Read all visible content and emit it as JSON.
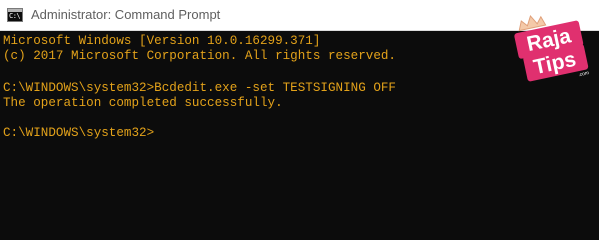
{
  "window": {
    "title": "Administrator: Command Prompt",
    "icon": "cmd-icon"
  },
  "console": {
    "lines": [
      "Microsoft Windows [Version 10.0.16299.371]",
      "(c) 2017 Microsoft Corporation. All rights reserved.",
      "C:\\WINDOWS\\system32>Bcdedit.exe -set TESTSIGNING OFF",
      "The operation completed successfully.",
      "C:\\WINDOWS\\system32>"
    ],
    "text_color": "#e3a21a",
    "background_color": "#0c0c0c"
  },
  "watermark": {
    "text": "Raja Tips .com",
    "color": "#e0306f"
  }
}
